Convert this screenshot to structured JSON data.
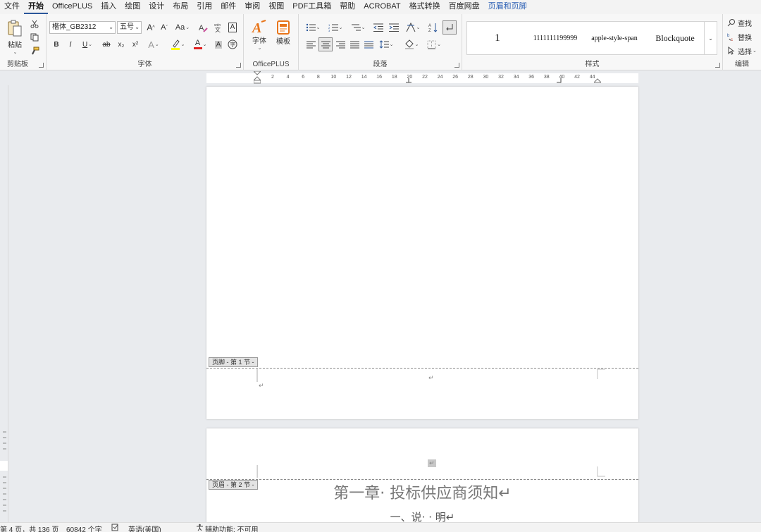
{
  "menu": {
    "items": [
      "文件",
      "开始",
      "OfficePLUS",
      "插入",
      "绘图",
      "设计",
      "布局",
      "引用",
      "邮件",
      "审阅",
      "视图",
      "PDF工具箱",
      "帮助",
      "ACROBAT",
      "格式转换",
      "百度网盘",
      "页眉和页脚"
    ],
    "active": "开始",
    "context_tab": "页眉和页脚"
  },
  "ribbon": {
    "clipboard": {
      "paste_label": "粘贴",
      "group_label": "剪贴板"
    },
    "font": {
      "font_name": "楷体_GB2312",
      "font_size": "五号",
      "grow_label": "A",
      "shrink_label": "A",
      "case_label": "Aa",
      "bold": "B",
      "italic": "I",
      "underline": "U",
      "strike": "ab",
      "subscript": "x₂",
      "superscript": "x²",
      "text_effect": "A",
      "font_color": "A",
      "char_shading": "A",
      "char_border": "A",
      "group_label": "字体"
    },
    "officeplus": {
      "font_label": "字体",
      "template_label": "模板",
      "group_label": "OfficePLUS"
    },
    "paragraph": {
      "group_label": "段落"
    },
    "styles": {
      "items": [
        "1",
        "1111111199999",
        "apple-style-span",
        "Blockquote"
      ],
      "group_label": "样式"
    },
    "editing": {
      "find_label": "查找",
      "replace_label": "替换",
      "select_label": "选择",
      "group_label": "编辑"
    }
  },
  "ruler": {
    "ticks": [
      "2",
      "4",
      "6",
      "8",
      "10",
      "12",
      "14",
      "16",
      "18",
      "20",
      "22",
      "24",
      "26",
      "28",
      "30",
      "32",
      "34",
      "36",
      "38",
      "40",
      "42",
      "44"
    ]
  },
  "document": {
    "footer_tag_page1": "页脚 - 第 1 节 -",
    "header_tag_page2": "页眉 - 第 2 节 -",
    "paragraph_mark": "↵",
    "chapter_title": "第一章· 投标供应商须知↵",
    "section_title": "一、说· · 明↵"
  },
  "status": {
    "page_info": "第 4 页，共 136 页",
    "word_count": "60842 个字",
    "language": "英语(美国)",
    "accessibility": "辅助功能: 不可用"
  },
  "colors": {
    "accent": "#2b579a",
    "context_tab": "#2b5fb4",
    "font_color_bar": "#e02020",
    "highlight_bar": "#ffff00"
  }
}
